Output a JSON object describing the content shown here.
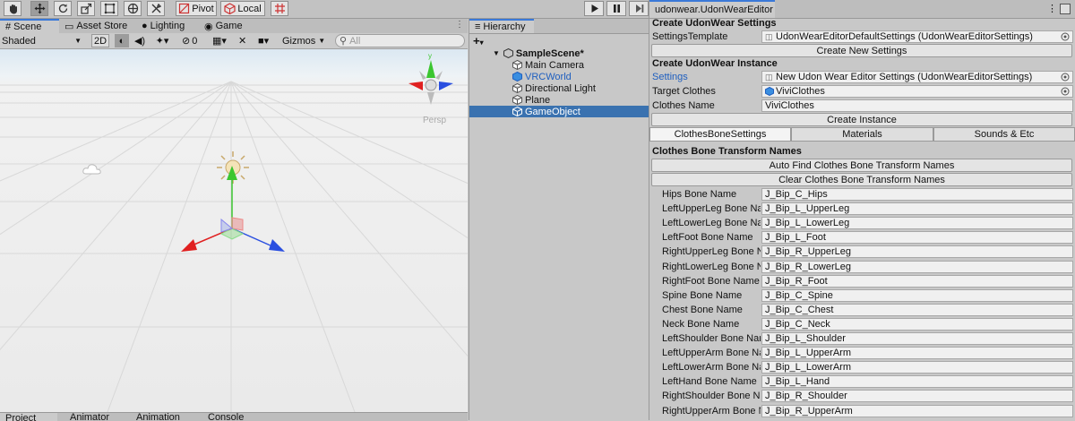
{
  "toolbar": {
    "tools": [
      "hand-tool",
      "move-tool",
      "rotate-tool",
      "scale-tool",
      "rect-tool",
      "transform-tool",
      "custom-tool"
    ],
    "pivot_label": "Pivot",
    "local_label": "Local"
  },
  "scene_panel": {
    "tabs": [
      "Scene",
      "Asset Store",
      "Lighting",
      "Game"
    ],
    "shading_mode": "Shaded",
    "mode_2d": "2D",
    "hidden_count": "0",
    "gizmos_label": "Gizmos",
    "search_placeholder": "All",
    "persp_label": "Persp"
  },
  "bottom_tabs": [
    "Project",
    "Animator",
    "Animation",
    "Console"
  ],
  "hierarchy": {
    "title": "Hierarchy",
    "scene_name": "SampleScene*",
    "items": [
      "Main Camera",
      "VRCWorld",
      "Directional Light",
      "Plane",
      "GameObject"
    ],
    "selected_item": "GameObject"
  },
  "inspector": {
    "tab_title": "udonwear.UdonWearEditor",
    "section_settings_title": "Create UdonWear Settings",
    "settings_template_label": "SettingsTemplate",
    "settings_template_value": "UdonWearEditorDefaultSettings (UdonWearEditorSettings)",
    "create_new_settings_button": "Create New Settings",
    "section_instance_title": "Create UdonWear Instance",
    "settings_label": "Settings",
    "settings_value": "New Udon Wear Editor Settings (UdonWearEditorSettings)",
    "target_clothes_label": "Target Clothes",
    "target_clothes_value": "ViviClothes",
    "clothes_name_label": "Clothes Name",
    "clothes_name_value": "ViviClothes",
    "create_instance_button": "Create Instance",
    "sub_tabs": [
      "ClothesBoneSettings",
      "Materials",
      "Sounds & Etc"
    ],
    "bone_section_title": "Clothes Bone Transform Names",
    "auto_find_button": "Auto Find Clothes Bone Transform Names",
    "clear_button": "Clear Clothes Bone Transform Names",
    "bones": [
      {
        "label": "Hips Bone Name",
        "value": "J_Bip_C_Hips"
      },
      {
        "label": "LeftUpperLeg Bone Na",
        "value": "J_Bip_L_UpperLeg"
      },
      {
        "label": "LeftLowerLeg Bone Na",
        "value": "J_Bip_L_LowerLeg"
      },
      {
        "label": "LeftFoot Bone Name",
        "value": "J_Bip_L_Foot"
      },
      {
        "label": "RightUpperLeg Bone N",
        "value": "J_Bip_R_UpperLeg"
      },
      {
        "label": "RightLowerLeg Bone N",
        "value": "J_Bip_R_LowerLeg"
      },
      {
        "label": "RightFoot Bone Name",
        "value": "J_Bip_R_Foot"
      },
      {
        "label": "Spine Bone Name",
        "value": "J_Bip_C_Spine"
      },
      {
        "label": "Chest Bone Name",
        "value": "J_Bip_C_Chest"
      },
      {
        "label": "Neck Bone Name",
        "value": "J_Bip_C_Neck"
      },
      {
        "label": "LeftShoulder Bone Nar",
        "value": "J_Bip_L_Shoulder"
      },
      {
        "label": "LeftUpperArm Bone Na",
        "value": "J_Bip_L_UpperArm"
      },
      {
        "label": "LeftLowerArm Bone Na",
        "value": "J_Bip_L_LowerArm"
      },
      {
        "label": "LeftHand Bone Name",
        "value": "J_Bip_L_Hand"
      },
      {
        "label": "RightShoulder Bone Na",
        "value": "J_Bip_R_Shoulder"
      },
      {
        "label": "RightUpperArm Bone N",
        "value": "J_Bip_R_UpperArm"
      }
    ]
  },
  "colors": {
    "selection": "#3a72b0",
    "link_blue": "#1f5fbf",
    "axis_x": "#e02020",
    "axis_y": "#3bc630",
    "axis_z": "#2a4fe0"
  }
}
